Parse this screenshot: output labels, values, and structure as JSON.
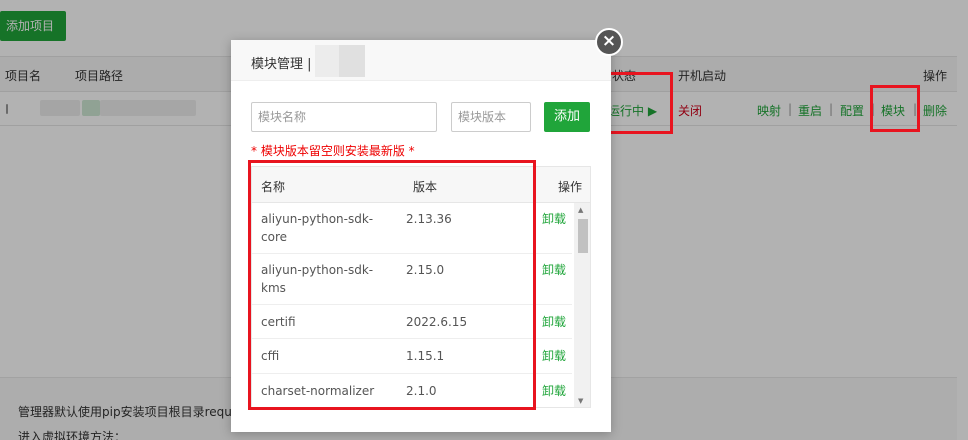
{
  "background": {
    "add_project_label": "添加项目",
    "table_headers": {
      "name": "项目名",
      "path": "项目路径",
      "status": "状态",
      "autostart": "开机启动",
      "actions": "操作"
    },
    "row": {
      "status": "运行中",
      "autostart": "关闭",
      "actions": [
        "映射",
        "重启",
        "配置",
        "模块",
        "删除"
      ]
    },
    "info_lines": [
      "管理器默认使用pip安装项目根目录requ",
      "进入虚拟环境方法："
    ]
  },
  "modal": {
    "title": "模块管理",
    "title_sep": "|",
    "close_icon": "close-icon",
    "inputs": {
      "module_name_placeholder": "模块名称",
      "module_version_placeholder": "模块版本"
    },
    "add_label": "添加",
    "hint": "* 模块版本留空则安装最新版 *",
    "table": {
      "headers": {
        "name": "名称",
        "version": "版本",
        "action": "操作"
      },
      "rows": [
        {
          "name": "aliyun-python-sdk-core",
          "version": "2.13.36",
          "action": "卸载"
        },
        {
          "name": "aliyun-python-sdk-kms",
          "version": "2.15.0",
          "action": "卸载"
        },
        {
          "name": "certifi",
          "version": "2022.6.15",
          "action": "卸载"
        },
        {
          "name": "cffi",
          "version": "1.15.1",
          "action": "卸载"
        },
        {
          "name": "charset-normalizer",
          "version": "2.1.0",
          "action": "卸载"
        }
      ]
    }
  },
  "colors": {
    "accent_green": "#20a53a",
    "highlight_red": "#e8141f",
    "hint_red": "#e00000"
  }
}
